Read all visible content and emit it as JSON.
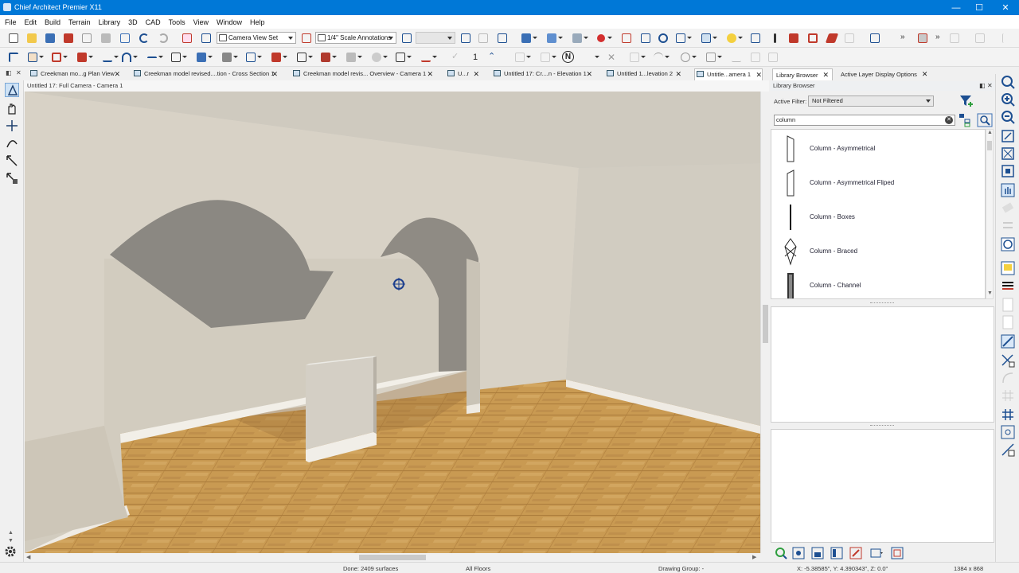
{
  "window": {
    "title": "Chief Architect Premier X11"
  },
  "menu": [
    "File",
    "Edit",
    "Build",
    "Terrain",
    "Library",
    "3D",
    "CAD",
    "Tools",
    "View",
    "Window",
    "Help"
  ],
  "toolbar": {
    "camera_view_set": "Camera View Set",
    "scale_annotations": "1/4\" Scale Annotations",
    "counter_value": "1"
  },
  "tabs": [
    {
      "label": "Creekman mo...g Plan View"
    },
    {
      "label": "Creekman model revised....tion - Cross Section 1"
    },
    {
      "label": "Creekman model revis... Overview - Camera 1"
    },
    {
      "label": "U...r"
    },
    {
      "label": "Untitled 17: Cr....n - Elevation 1"
    },
    {
      "label": "Untitled 1...levation 2"
    },
    {
      "label": "Untitle...amera 1"
    }
  ],
  "viewport": {
    "title": "Untitled 17: Full Camera - Camera 1"
  },
  "library": {
    "tabs": [
      {
        "label": "Library Browser"
      },
      {
        "label": "Active Layer Display Options"
      }
    ],
    "panel_title": "Library Browser",
    "active_filter_label": "Active Filter:",
    "active_filter_value": "Not Filtered",
    "search_value": "column",
    "items": [
      {
        "name": "Column - Asymmetrical"
      },
      {
        "name": "Column - Asymmetrical Fliped"
      },
      {
        "name": "Column - Boxes"
      },
      {
        "name": "Column - Braced"
      },
      {
        "name": "Column - Channel"
      }
    ]
  },
  "status": {
    "done": "Done:   2409 surfaces",
    "floors": "All Floors",
    "drawing_group": "Drawing Group: -",
    "coords": "X: -5.38585\", Y: 4.390343\", Z: 0.0\"",
    "resolution": "1384 x 868"
  },
  "colors": {
    "titlebar": "#0078d7",
    "floor": "#c99a52",
    "wall": "#d6d0c4",
    "shadow": "#8d8a83"
  }
}
